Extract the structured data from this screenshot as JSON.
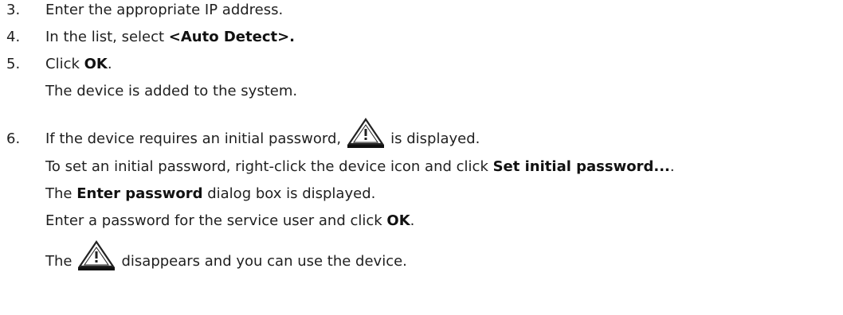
{
  "steps": {
    "s3": {
      "num": "3.",
      "text": "Enter the appropriate IP address."
    },
    "s4": {
      "num": "4.",
      "pre": "In the list, select ",
      "bold": "<Auto Detect>."
    },
    "s5": {
      "num": "5.",
      "pre": "Click ",
      "bold": "OK",
      "post": ".",
      "result": "The device is added to the system."
    },
    "s6": {
      "num": "6.",
      "line1_pre": "If the device requires an initial password,",
      "line1_post": "is displayed.",
      "line2_pre": "To set an initial password, right-click the device icon and click ",
      "line2_bold": "Set initial password...",
      "line2_post": ".",
      "line3_pre": "The ",
      "line3_bold": "Enter password",
      "line3_post": " dialog box is displayed.",
      "line4_pre": "Enter a password for the service user and click ",
      "line4_bold": "OK",
      "line4_post": ".",
      "line5_pre": "The",
      "line5_post": "disappears and you can use the device."
    }
  },
  "icons": {
    "warning": "warning-triangle-icon"
  }
}
